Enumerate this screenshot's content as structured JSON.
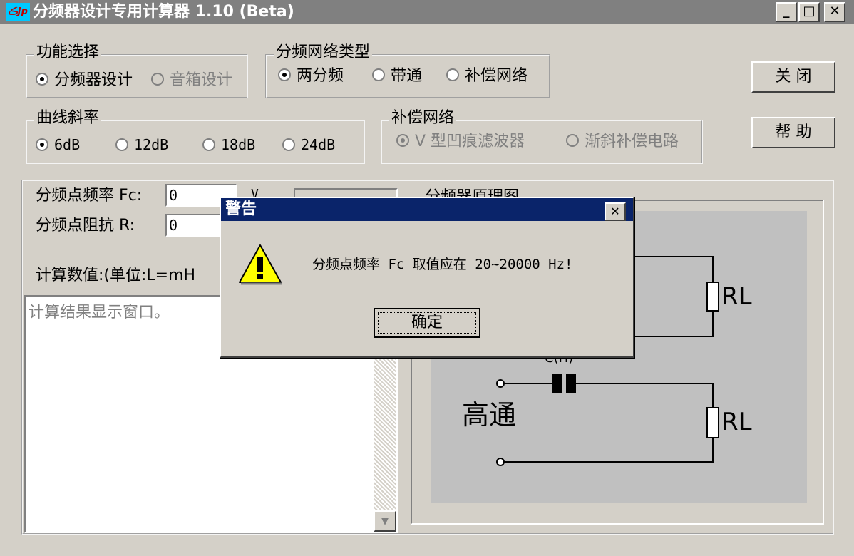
{
  "window": {
    "title": "分频器设计专用计算器 1.10 (Beta)",
    "icon_text": "ڪJp",
    "min_glyph": "_",
    "max_glyph": "□",
    "close_glyph": "✕"
  },
  "function_group": {
    "legend": "功能选择",
    "options": [
      {
        "label": "分频器设计",
        "selected": true,
        "disabled": false
      },
      {
        "label": "音箱设计",
        "selected": false,
        "disabled": true
      }
    ]
  },
  "network_type_group": {
    "legend": "分频网络类型",
    "options": [
      {
        "label": "两分频",
        "selected": true
      },
      {
        "label": "带通",
        "selected": false
      },
      {
        "label": "补偿网络",
        "selected": false
      }
    ]
  },
  "slope_group": {
    "legend": "曲线斜率",
    "options": [
      {
        "label": "6dB",
        "selected": true
      },
      {
        "label": "12dB",
        "selected": false
      },
      {
        "label": "18dB",
        "selected": false
      },
      {
        "label": "24dB",
        "selected": false
      }
    ]
  },
  "compensation_group": {
    "legend": "补偿网络",
    "options": [
      {
        "label": "V 型凹痕滤波器",
        "selected": true,
        "disabled": true
      },
      {
        "label": "渐斜补偿电路",
        "selected": false,
        "disabled": true
      }
    ]
  },
  "buttons": {
    "close": "关 闭",
    "help": "帮 助"
  },
  "inputs": {
    "fc_label": "分频点频率 Fc:",
    "fc_value": "0",
    "r_label": "分频点阻抗 R:",
    "r_value": "0",
    "side_label_partial": "V",
    "calc_label": "计算数值:(单位:L=mH",
    "result_text": "计算结果显示窗口。"
  },
  "schematic": {
    "title_partial": "分频器原理图",
    "high_pass_label": "高通",
    "cap_label_partial": "C(H)",
    "resistor_label_top": "RL",
    "resistor_label_bottom": "RL"
  },
  "dialog": {
    "title": "警告",
    "message": "分频点频率 Fc 取值应在 20~20000 Hz!",
    "ok_label": "确定",
    "close_glyph": "✕",
    "icon": "warning-triangle-icon"
  },
  "scroll_down_glyph": "▼"
}
